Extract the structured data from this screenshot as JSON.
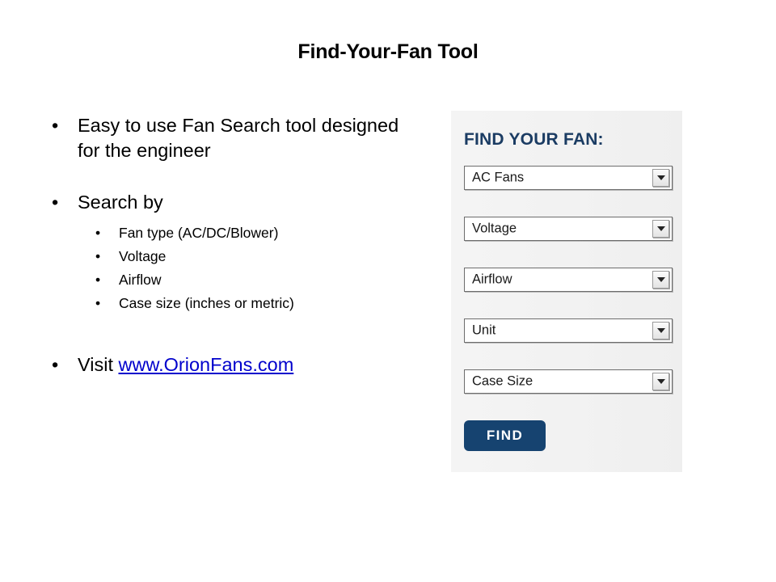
{
  "slide": {
    "title": "Find-Your-Fan Tool"
  },
  "content": {
    "bullets": [
      {
        "text": "Easy to use Fan Search tool designed for the engineer"
      },
      {
        "text": "Search by",
        "sub": [
          "Fan type (AC/DC/Blower)",
          "Voltage",
          "Airflow",
          "Case size (inches or metric)"
        ]
      }
    ],
    "visit": {
      "prefix": "Visit ",
      "link_text": "www.OrionFans.com"
    }
  },
  "widget": {
    "heading": "FIND YOUR FAN:",
    "selects": [
      {
        "value": "AC Fans",
        "icon": "chevron-down-icon"
      },
      {
        "value": "Voltage",
        "icon": "chevron-down-icon"
      },
      {
        "value": "Airflow",
        "icon": "chevron-down-icon"
      },
      {
        "value": "Unit",
        "icon": "chevron-down-icon"
      },
      {
        "value": "Case Size",
        "icon": "chevron-down-icon"
      }
    ],
    "find_button_label": "FIND"
  },
  "colors": {
    "heading_navy": "#1b3c63",
    "button_navy": "#164370",
    "link_blue": "#0000cc",
    "panel_bg": "#f2f2f2",
    "page_bg": "#ffffff",
    "text_black": "#000000"
  },
  "bullet_glyph": "•"
}
